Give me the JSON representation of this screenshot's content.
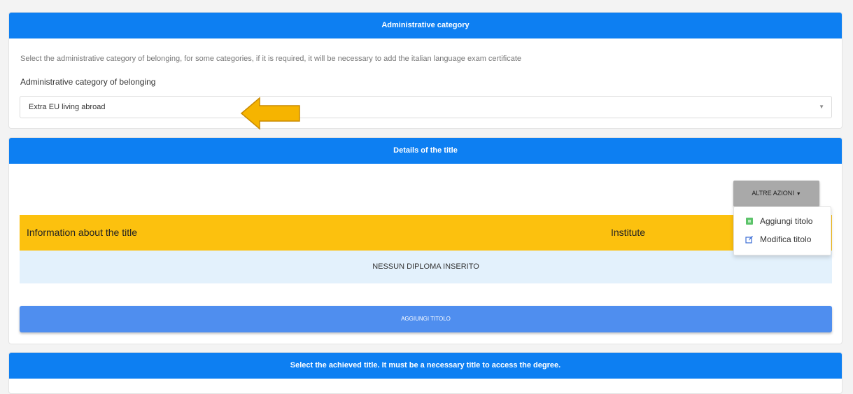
{
  "admin_section": {
    "header": "Administrative category",
    "description": "Select the administrative category of belonging, for some categories, if it is required, it will be necessary to add the italian language exam certificate",
    "field_label": "Administrative category of belonging",
    "selected_value": "Extra EU living abroad"
  },
  "title_section": {
    "header": "Details of the title",
    "more_actions_label": "ALTRE AZIONI",
    "columns": [
      "Information about the title",
      "Institute"
    ],
    "empty_message": "NESSUN DIPLOMA INSERITO",
    "add_button_label": "AGGIUNGI TITOLO"
  },
  "dropdown": {
    "items": [
      {
        "label": "Aggiungi titolo",
        "icon": "add-icon"
      },
      {
        "label": "Modifica titolo",
        "icon": "edit-icon"
      }
    ]
  },
  "select_section": {
    "header": "Select the achieved title. It must be a necessary title to access the degree."
  },
  "colors": {
    "header_blue": "#0d7ff2",
    "table_header_yellow": "#fcc10e",
    "empty_row_blue": "#e3f1fc",
    "add_button_blue": "#4f8eef",
    "annotation_arrow": "#f6b400"
  }
}
